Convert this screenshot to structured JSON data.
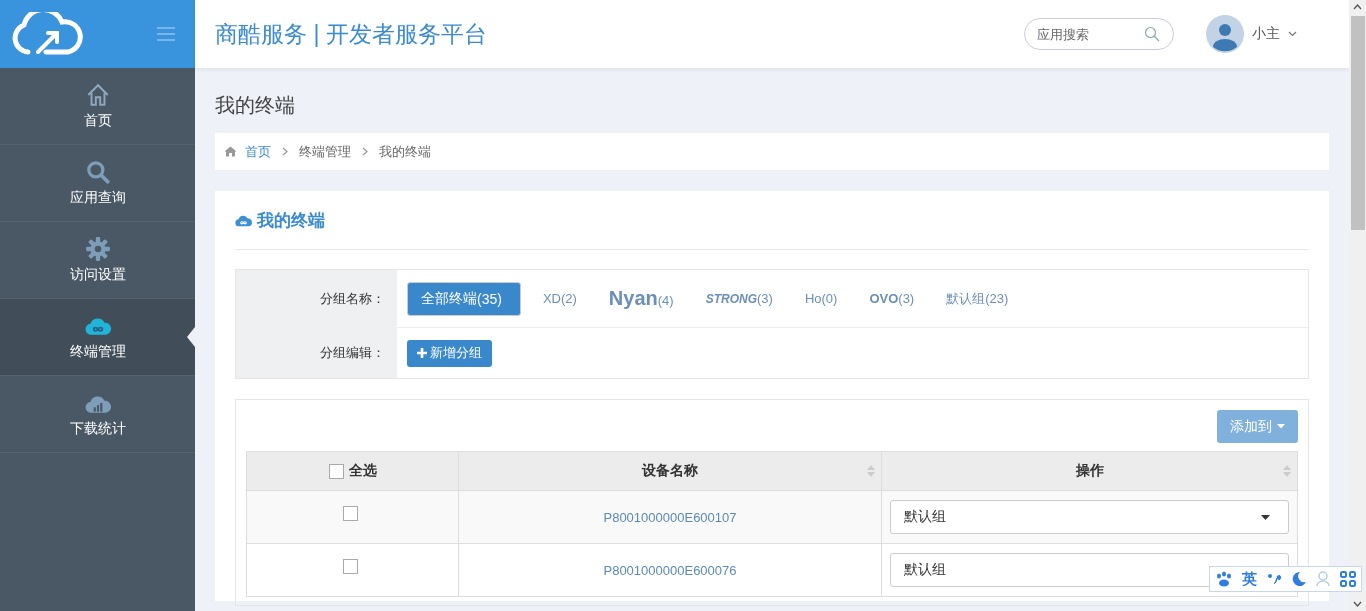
{
  "header": {
    "title": "商酷服务 | 开发者服务平台",
    "search": {
      "placeholder": "应用搜索"
    },
    "user": {
      "name": "小主"
    }
  },
  "sidebar": {
    "items": [
      {
        "label": "首页",
        "selected": false
      },
      {
        "label": "应用查询",
        "selected": false
      },
      {
        "label": "访问设置",
        "selected": false
      },
      {
        "label": "终端管理",
        "selected": true
      },
      {
        "label": "下载统计",
        "selected": false
      }
    ]
  },
  "page_title": "我的终端",
  "breadcrumb": [
    {
      "label": "首页",
      "link": true
    },
    {
      "label": "终端管理",
      "link": false
    },
    {
      "label": "我的终端",
      "link": false
    }
  ],
  "card": {
    "title": "我的终端",
    "filter": {
      "group_label": "分组名称：",
      "groups": [
        {
          "name": "全部终端",
          "count": "(35)",
          "kind": "plain",
          "selected": true
        },
        {
          "name": "XD",
          "count": "(2)",
          "kind": "plain",
          "selected": false
        },
        {
          "name": "Nyan",
          "count": "(4)",
          "kind": "large",
          "selected": false
        },
        {
          "name": "STRONG",
          "count": "(3)",
          "kind": "italic",
          "selected": false
        },
        {
          "name": "Ho",
          "count": "(0)",
          "kind": "plain",
          "selected": false
        },
        {
          "name": "OVO",
          "count": "(3)",
          "kind": "bold",
          "selected": false
        },
        {
          "name": "默认组",
          "count": "(23)",
          "kind": "plain",
          "selected": false
        }
      ],
      "edit_label": "分组编辑：",
      "add_button": "新增分组"
    },
    "add_to_button": "添加到",
    "table": {
      "columns": [
        {
          "label": "全选",
          "kind": "select-all",
          "checked": false
        },
        {
          "label": "设备名称",
          "kind": "sortable"
        },
        {
          "label": "操作",
          "kind": "sortable"
        }
      ],
      "rows": [
        {
          "checked": false,
          "device": "P8001000000E600107",
          "group": "默认组"
        },
        {
          "checked": false,
          "device": "P8001000000E600076",
          "group": "默认组"
        }
      ]
    }
  },
  "ime_toolbar": {
    "mode": "英"
  }
}
